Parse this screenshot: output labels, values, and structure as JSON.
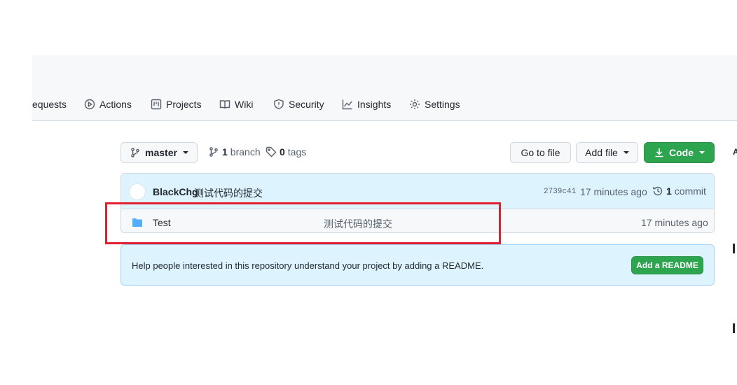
{
  "nav": {
    "items": [
      {
        "label": "equests",
        "icon": "pull-request-icon"
      },
      {
        "label": "Actions",
        "icon": "play-icon"
      },
      {
        "label": "Projects",
        "icon": "project-icon"
      },
      {
        "label": "Wiki",
        "icon": "book-icon"
      },
      {
        "label": "Security",
        "icon": "shield-icon"
      },
      {
        "label": "Insights",
        "icon": "graph-icon"
      },
      {
        "label": "Settings",
        "icon": "gear-icon"
      }
    ]
  },
  "toolbar": {
    "branch_label": "master",
    "branch_count": "1",
    "branch_word": "branch",
    "tag_count": "0",
    "tag_word": "tags",
    "go_to_file": "Go to file",
    "add_file": "Add file",
    "code": "Code"
  },
  "commit": {
    "author": "BlackChg",
    "message": "测试代码的提交",
    "hash": "2739c41",
    "time": "17 minutes ago",
    "commit_count": "1",
    "commit_word": "commit"
  },
  "files": [
    {
      "name": "Test",
      "message": "测试代码的提交",
      "time": "17 minutes ago",
      "icon": "folder-icon"
    }
  ],
  "readme": {
    "text": "Help people interested in this repository understand your project by adding a README.",
    "button": "Add a README"
  },
  "colors": {
    "green": "#2da44e",
    "highlight": "#e0202f",
    "folder": "#54aeff",
    "banner": "#ddf4ff"
  }
}
